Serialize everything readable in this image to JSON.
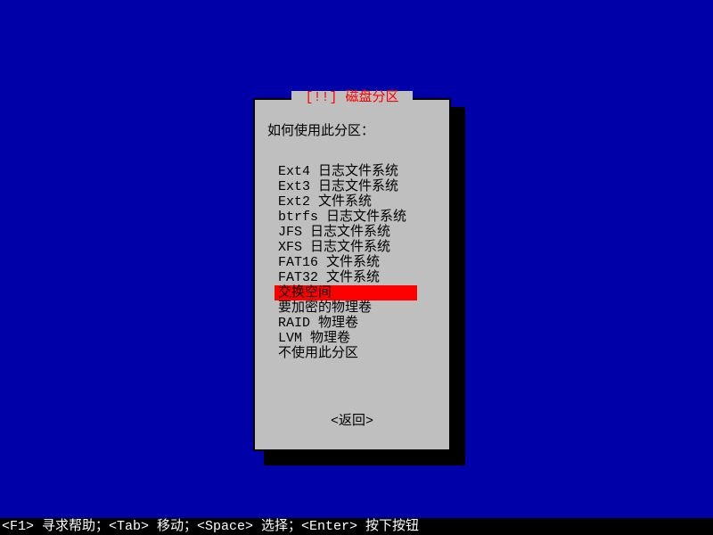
{
  "dialog": {
    "title": " [!!] 磁盘分区 ",
    "prompt": "如何使用此分区：",
    "menu": [
      {
        "label": "Ext4 日志文件系统",
        "selected": false
      },
      {
        "label": "Ext3 日志文件系统",
        "selected": false
      },
      {
        "label": "Ext2 文件系统",
        "selected": false
      },
      {
        "label": "btrfs 日志文件系统",
        "selected": false
      },
      {
        "label": "JFS 日志文件系统",
        "selected": false
      },
      {
        "label": "XFS 日志文件系统",
        "selected": false
      },
      {
        "label": "FAT16 文件系统",
        "selected": false
      },
      {
        "label": "FAT32 文件系统",
        "selected": false
      },
      {
        "label": "交换空间",
        "selected": true
      },
      {
        "label": "要加密的物理卷",
        "selected": false
      },
      {
        "label": "RAID 物理卷",
        "selected": false
      },
      {
        "label": "LVM 物理卷",
        "selected": false
      },
      {
        "label": "不使用此分区",
        "selected": false
      }
    ],
    "back": "<返回>"
  },
  "hintbar": "<F1> 寻求帮助；<Tab> 移动；<Space> 选择；<Enter> 按下按钮"
}
